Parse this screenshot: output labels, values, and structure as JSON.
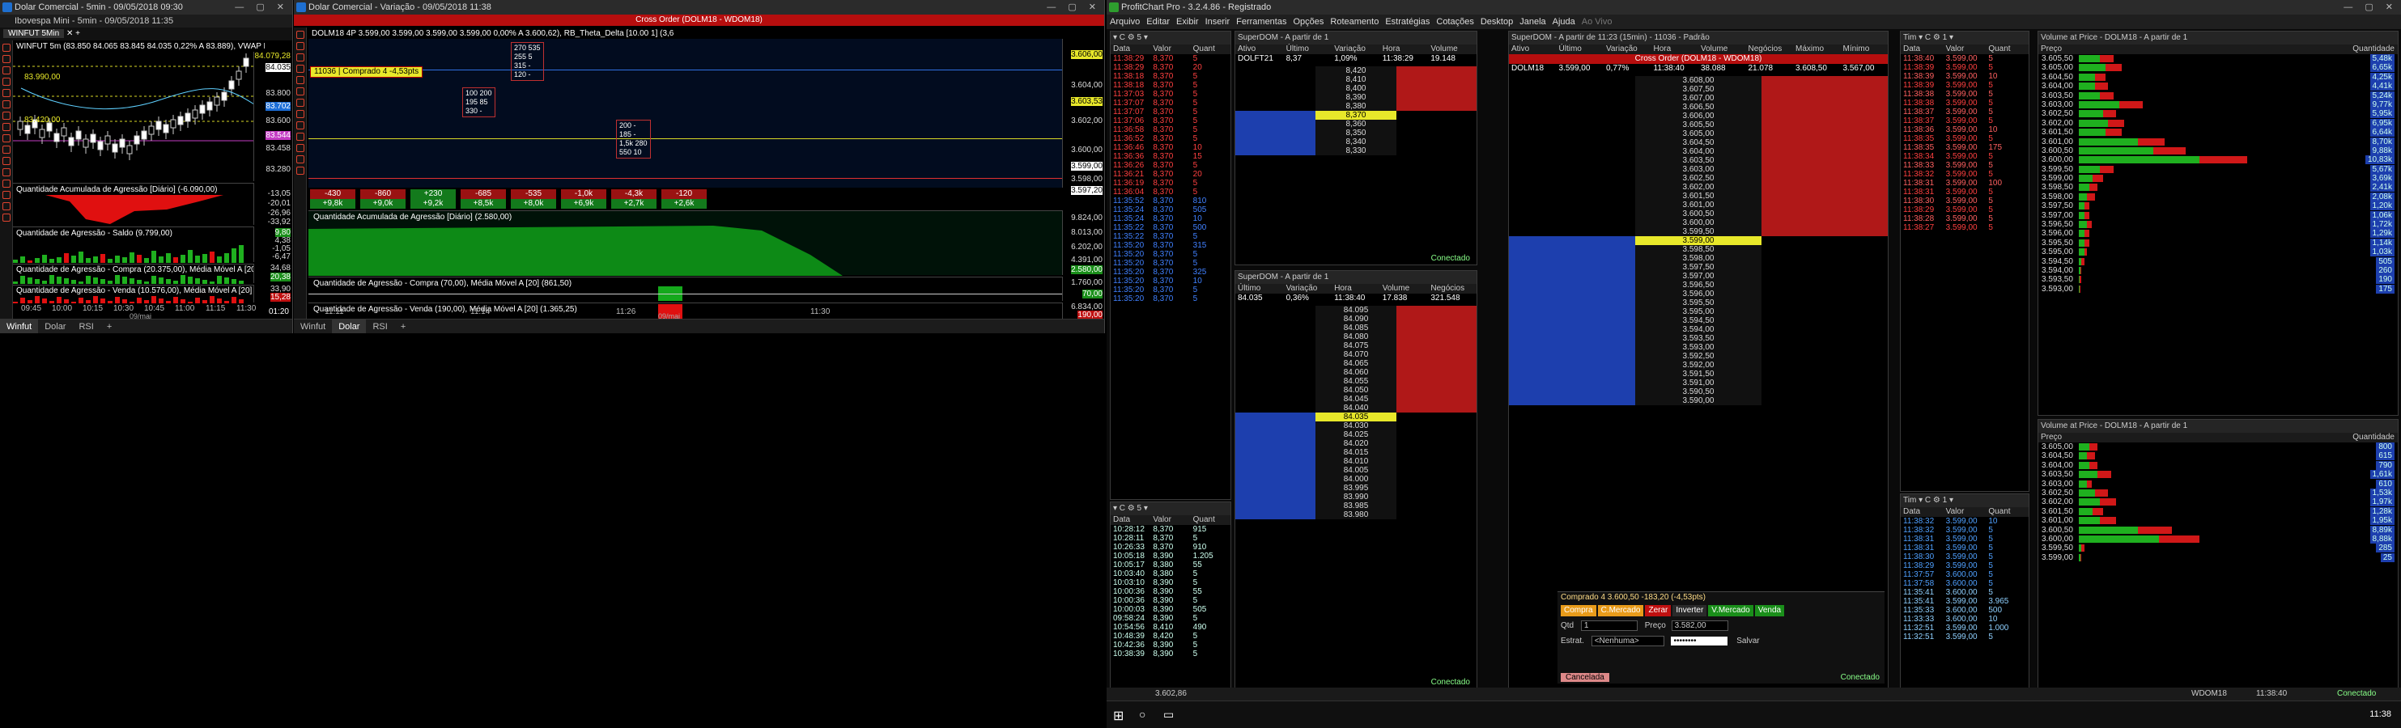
{
  "left": {
    "title": "Dolar Comercial - 5min - 09/05/2018 09:30",
    "subtitle": "Ibovespa Mini - 5min - 09/05/2018 11:35",
    "tab_label": "WINFUT 5Min",
    "header_text": "WINFUT 5m (83.850  84.065  83.845  84.035  0,22%  A 83.889), VWAP D (83.701,59), VWAP S (83.506,48",
    "price_labels": [
      "84.079,28",
      "84.035",
      "83.800",
      "83.702",
      "83.600",
      "83.544",
      "83.458",
      "83.280"
    ],
    "panel1": "Quantidade Acumulada de Agressão [Diário] (-6.090,00)",
    "panel1_axis": [
      "-13,05",
      "-20,01",
      "-26,96",
      "-33,92"
    ],
    "panel2": "Quantidade de Agressão - Saldo (9.799,00)",
    "panel2_axis": [
      "9,80",
      "4,38",
      "-1,05",
      "-6,47"
    ],
    "panel3": "Quantidade de Agressão - Compra (20.375,00), Média Móvel A [20] (15.495,95)",
    "panel3_axis": [
      "34,68",
      "20,38",
      "13,38"
    ],
    "panel4": "Quantidade de Agressão - Venda (10.576,00), Média Móvel A [20] (15.284,20)",
    "panel4_axis": [
      "33,90",
      "15,28"
    ],
    "xlabels": [
      "09:45",
      "10:00",
      "10:15",
      "10:30",
      "10:45",
      "11:00",
      "11:15",
      "11:30"
    ],
    "xdate": "09/mai",
    "time_box": "01:20",
    "bottom_tabs": [
      "Winfut",
      "Dolar",
      "RSI"
    ],
    "overlay_labels": [
      "83.990,00",
      "83.420,00"
    ]
  },
  "mid": {
    "title": "Dolar Comercial - Variação - 09/05/2018 11:38",
    "banner": "Cross Order (DOLM18 - WDOM18)",
    "header_text": "DOLM18 4P  3.599,00  3.599,00  3.599,00  3.599,00  0,00%  A 3.600,62), RB_Theta_Delta [10.00 1] (3,6",
    "order_box": "11036 | Comprado 4  -4,53pts",
    "price_axis": [
      "3.606,00",
      "3.604,00",
      "3.603,53",
      "3.602,00",
      "3.600,00",
      "3.599,00",
      "3.598,00",
      "3.597,20"
    ],
    "delta_row": [
      "-430",
      "-860",
      "+230",
      "-685",
      "-535",
      "-1,0k",
      "-4,3k",
      "-120"
    ],
    "cum_row": [
      "+9,8k",
      "+9,0k",
      "+9,2k",
      "+8,5k",
      "+8,0k",
      "+6,9k",
      "+2,7k",
      "+2,6k"
    ],
    "panel1": "Quantidade Acumulada de Agressão [Diário] (2.580,00)",
    "panel1_axis": [
      "9.824,00",
      "8.013,00",
      "6.202,00",
      "4.391,00",
      "2.580,00"
    ],
    "panel2": "Quantidade de Agressão - Compra (70,00), Média Móvel A [20] (861,50)",
    "panel2_axis": [
      "1.760,00",
      "70,00"
    ],
    "panel3": "Quantidade de Agressão - Venda (190,00), Média Móvel A [20] (1.365,25)",
    "panel3_axis": [
      "6.834,00",
      "1.365,25",
      "190,00"
    ],
    "xlabels": [
      "11:11",
      "11:14",
      "11:26",
      "11:30"
    ],
    "xdate": "09/mai",
    "bottom_tabs": [
      "Winfut",
      "Dolar",
      "RSI"
    ],
    "footprint": [
      {
        "top": "270  535",
        "rows": [
          "255  5",
          "315  -",
          "120  -"
        ]
      },
      {
        "top": "100  200",
        "rows": [
          "195  85",
          "330  -"
        ]
      },
      {
        "top": "200  -",
        "rows": [
          "185  -",
          "1,5k  280",
          "550  10"
        ]
      }
    ]
  },
  "profit": {
    "title": "ProfitChart Pro - 3.2.4.86 - Registrado",
    "menu": [
      "Arquivo",
      "Editar",
      "Exibir",
      "Inserir",
      "Ferramentas",
      "Opções",
      "Roteamento",
      "Estratégias",
      "Cotações",
      "Desktop",
      "Janela",
      "Ajuda",
      "Ao Vivo"
    ],
    "times1_rows": [
      [
        "11:38:29",
        "8,370",
        "5"
      ],
      [
        "11:38:29",
        "8,370",
        "20"
      ],
      [
        "11:38:18",
        "8,370",
        "5"
      ],
      [
        "11:38:18",
        "8,370",
        "5"
      ],
      [
        "11:37:03",
        "8,370",
        "5"
      ],
      [
        "11:37:07",
        "8,370",
        "5"
      ],
      [
        "11:37:07",
        "8,370",
        "5"
      ],
      [
        "11:37:06",
        "8,370",
        "5"
      ],
      [
        "11:36:58",
        "8,370",
        "5"
      ],
      [
        "11:36:52",
        "8,370",
        "5"
      ],
      [
        "11:36:46",
        "8,370",
        "10"
      ],
      [
        "11:36:36",
        "8,370",
        "15"
      ],
      [
        "11:36:26",
        "8,370",
        "5"
      ],
      [
        "11:36:21",
        "8,370",
        "20"
      ],
      [
        "11:36:19",
        "8,370",
        "5"
      ],
      [
        "11:36:04",
        "8,370",
        "5"
      ],
      [
        "11:35:52",
        "8,370",
        "810"
      ],
      [
        "11:35:24",
        "8,370",
        "505"
      ],
      [
        "11:35:24",
        "8,370",
        "10"
      ],
      [
        "11:35:22",
        "8,370",
        "500"
      ],
      [
        "11:35:22",
        "8,370",
        "5"
      ],
      [
        "11:35:20",
        "8,370",
        "315"
      ],
      [
        "11:35:20",
        "8,370",
        "5"
      ],
      [
        "11:35:20",
        "8,370",
        "5"
      ],
      [
        "11:35:20",
        "8,370",
        "325"
      ],
      [
        "11:35:20",
        "8,370",
        "10"
      ],
      [
        "11:35:20",
        "8,370",
        "5"
      ],
      [
        "11:35:20",
        "8,370",
        "5"
      ]
    ],
    "times2_rows": [
      [
        "10:28:12",
        "8,370",
        "915"
      ],
      [
        "10:28:11",
        "8,370",
        "5"
      ],
      [
        "10:26:33",
        "8,370",
        "910"
      ],
      [
        "10:05:18",
        "8,390",
        "1.205"
      ],
      [
        "10:05:17",
        "8,380",
        "55"
      ],
      [
        "10:03:40",
        "8,380",
        "5"
      ],
      [
        "10:03:10",
        "8,390",
        "5"
      ],
      [
        "10:00:36",
        "8,390",
        "55"
      ],
      [
        "10:00:36",
        "8,390",
        "5"
      ],
      [
        "10:00:03",
        "8,390",
        "505"
      ],
      [
        "09:58:24",
        "8,390",
        "5"
      ],
      [
        "10:54:56",
        "8,410",
        "490"
      ],
      [
        "10:48:39",
        "8,420",
        "5"
      ],
      [
        "10:42:36",
        "8,390",
        "5"
      ],
      [
        "10:38:39",
        "8,390",
        "5"
      ]
    ],
    "superdom1": {
      "title": "SuperDOM - A partir de 1",
      "hdr": [
        "Ativo",
        "Último",
        "Variação",
        "Hora",
        "Volume"
      ],
      "row": [
        "DOLFT21",
        "8,37",
        "1,09%",
        "11:38:29",
        "19.148"
      ]
    },
    "superdom2": {
      "title": "SuperDOM - A partir de 1",
      "hdr": [
        "Último",
        "Variação",
        "Hora",
        "Volume",
        "Negócios"
      ],
      "row": [
        "84.035",
        "0,36%",
        "11:38:40",
        "17.838",
        "321.548"
      ]
    },
    "superdom3": {
      "title": "SuperDOM - A partir de 11:23 (15min) - 11036 - Padrão",
      "hdr": [
        "Ativo",
        "Último",
        "Variação",
        "Hora",
        "Volume",
        "Negócios",
        "Máximo",
        "Mínimo"
      ],
      "row": [
        "DOLM18",
        "3.599,00",
        "0,77%",
        "11:38:40",
        "38.088",
        "21.078",
        "3.608,50",
        "3.567,00"
      ]
    },
    "cross_order": "Cross Order (DOLM18 - WDOM18)",
    "conectado": "Conectado",
    "dom1_prices": [
      "8,420",
      "8,410",
      "8,400",
      "8,390",
      "8,380",
      "8,370",
      "8,360",
      "8,350",
      "8,340",
      "8,330"
    ],
    "dom2_prices": [
      "84.095",
      "84.090",
      "84.085",
      "84.080",
      "84.075",
      "84.070",
      "84.065",
      "84.060",
      "84.055",
      "84.050",
      "84.045",
      "84.040",
      "84.035",
      "84.030",
      "84.025",
      "84.020",
      "84.015",
      "84.010",
      "84.005",
      "84.000",
      "83.995",
      "83.990",
      "83.985",
      "83.980"
    ],
    "dom3_prices": [
      "3.608,00",
      "3.607,50",
      "3.607,00",
      "3.606,50",
      "3.606,00",
      "3.605,50",
      "3.605,00",
      "3.604,50",
      "3.604,00",
      "3.603,50",
      "3.603,00",
      "3.602,50",
      "3.602,00",
      "3.601,50",
      "3.601,00",
      "3.600,50",
      "3.600,00",
      "3.599,50",
      "3.599,00",
      "3.598,50",
      "3.598,00",
      "3.597,50",
      "3.597,00",
      "3.596,50",
      "3.596,00",
      "3.595,50",
      "3.595,00",
      "3.594,50",
      "3.594,00",
      "3.593,50",
      "3.593,00",
      "3.592,50",
      "3.592,00",
      "3.591,50",
      "3.591,00",
      "3.590,50",
      "3.590,00"
    ],
    "order_line": "Comprado 4  3.600,50  -183,20 (-4,53pts)",
    "buttons": [
      "Compra",
      "C.Mercado",
      "Zerar",
      "Inverter",
      "V.Mercado",
      "Venda"
    ],
    "qtd_label": "Qtd",
    "qtd_value": "1",
    "preco_label": "Preço",
    "preco_value": "3.582,00",
    "estrat_label": "Estrat.",
    "estrat_value": "<Nenhuma>",
    "salvar": "Salvar",
    "cancelada": "Cancelada",
    "times3_rows": [
      [
        "11:38:40",
        "3.599,00",
        "5"
      ],
      [
        "11:38:39",
        "3.599,00",
        "5"
      ],
      [
        "11:38:39",
        "3.599,00",
        "10"
      ],
      [
        "11:38:39",
        "3.599,00",
        "5"
      ],
      [
        "11:38:38",
        "3.599,00",
        "5"
      ],
      [
        "11:38:38",
        "3.599,00",
        "5"
      ],
      [
        "11:38:37",
        "3.599,00",
        "5"
      ],
      [
        "11:38:37",
        "3.599,00",
        "5"
      ],
      [
        "11:38:36",
        "3.599,00",
        "10"
      ],
      [
        "11:38:35",
        "3.599,00",
        "5"
      ],
      [
        "11:38:35",
        "3.599,00",
        "175"
      ],
      [
        "11:38:34",
        "3.599,00",
        "5"
      ],
      [
        "11:38:33",
        "3.599,00",
        "5"
      ],
      [
        "11:38:32",
        "3.599,00",
        "5"
      ],
      [
        "11:38:31",
        "3.599,00",
        "100"
      ],
      [
        "11:38:31",
        "3.599,00",
        "5"
      ],
      [
        "11:38:30",
        "3.599,00",
        "5"
      ],
      [
        "11:38:29",
        "3.599,00",
        "5"
      ],
      [
        "11:38:28",
        "3.599,00",
        "5"
      ],
      [
        "11:38:27",
        "3.599,00",
        "5"
      ]
    ],
    "times4_rows": [
      [
        "11:38:32",
        "3.599,00",
        "10"
      ],
      [
        "11:38:32",
        "3.599,00",
        "5"
      ],
      [
        "11:38:31",
        "3.599,00",
        "5"
      ],
      [
        "11:38:31",
        "3.599,00",
        "5"
      ],
      [
        "11:38:30",
        "3.599,00",
        "5"
      ],
      [
        "11:38:29",
        "3.599,00",
        "5"
      ],
      [
        "11:37:57",
        "3.600,00",
        "5"
      ],
      [
        "11:37:58",
        "3.600,00",
        "5"
      ],
      [
        "11:35:41",
        "3.600,00",
        "5"
      ],
      [
        "11:35:41",
        "3.599,00",
        "3.965"
      ],
      [
        "11:35:33",
        "3.600,00",
        "500"
      ],
      [
        "11:33:33",
        "3.600,00",
        "10"
      ],
      [
        "11:32:51",
        "3.599,00",
        "1.000"
      ],
      [
        "11:32:51",
        "3.599,00",
        "5"
      ]
    ],
    "vap1_title": "Volume at Price - DOLM18 - A partir de 1",
    "vap1_rows": [
      [
        "3.605,50",
        "5,48k",
        0.08,
        0.05
      ],
      [
        "3.605,00",
        "6,65k",
        0.1,
        0.06
      ],
      [
        "3.604,50",
        "4,25k",
        0.06,
        0.04
      ],
      [
        "3.604,00",
        "4,41k",
        0.06,
        0.05
      ],
      [
        "3.603,50",
        "5,24k",
        0.08,
        0.05
      ],
      [
        "3.603,00",
        "9,77k",
        0.15,
        0.09
      ],
      [
        "3.602,50",
        "5,95k",
        0.09,
        0.05
      ],
      [
        "3.602,00",
        "6,95k",
        0.11,
        0.06
      ],
      [
        "3.601,50",
        "6,64k",
        0.1,
        0.06
      ],
      [
        "3.601,00",
        "8,70k",
        0.22,
        0.1
      ],
      [
        "3.600,50",
        "9,88k",
        0.28,
        0.12
      ],
      [
        "3.600,00",
        "10,83k",
        0.45,
        0.18
      ],
      [
        "3.599,50",
        "5,67k",
        0.08,
        0.05
      ],
      [
        "3.599,00",
        "3,69k",
        0.05,
        0.04
      ],
      [
        "3.598,50",
        "2,41k",
        0.04,
        0.03
      ],
      [
        "3.598,00",
        "2,08k",
        0.03,
        0.03
      ],
      [
        "3.597,50",
        "1,20k",
        0.02,
        0.02
      ],
      [
        "3.597,00",
        "1,06k",
        0.02,
        0.02
      ],
      [
        "3.596,50",
        "1,72k",
        0.03,
        0.02
      ],
      [
        "3.596,00",
        "1,29k",
        0.02,
        0.02
      ],
      [
        "3.595,50",
        "1,14k",
        0.02,
        0.02
      ],
      [
        "3.595,00",
        "1,03k",
        0.02,
        0.01
      ],
      [
        "3.594,50",
        "505",
        0.01,
        0.01
      ],
      [
        "3.594,00",
        "260",
        0.005,
        0.005
      ],
      [
        "3.593,50",
        "190",
        0.004,
        0.004
      ],
      [
        "3.593,00",
        "175",
        0.004,
        0.003
      ]
    ],
    "vap2_title": "Volume at Price - DOLM18 - A partir de 1",
    "vap2_rows": [
      [
        "3.605,00",
        "800",
        0.04,
        0.03
      ],
      [
        "3.604,50",
        "615",
        0.03,
        0.03
      ],
      [
        "3.604,00",
        "790",
        0.04,
        0.03
      ],
      [
        "3.603,50",
        "1,61k",
        0.07,
        0.05
      ],
      [
        "3.603,00",
        "610",
        0.03,
        0.02
      ],
      [
        "3.602,50",
        "1,53k",
        0.06,
        0.05
      ],
      [
        "3.602,00",
        "1,97k",
        0.08,
        0.06
      ],
      [
        "3.601,50",
        "1,28k",
        0.05,
        0.04
      ],
      [
        "3.601,00",
        "1,95k",
        0.08,
        0.06
      ],
      [
        "3.600,50",
        "8,89k",
        0.22,
        0.13
      ],
      [
        "3.600,00",
        "8,88k",
        0.3,
        0.15
      ],
      [
        "3.599,50",
        "285",
        0.01,
        0.01
      ],
      [
        "3.599,00",
        "25",
        0.005,
        0.004
      ]
    ],
    "status_asset": "WDOM18",
    "status_time": "11:38:40",
    "status_conn": "Conectado",
    "status_left": "3.602,86",
    "clock": "11:38"
  }
}
